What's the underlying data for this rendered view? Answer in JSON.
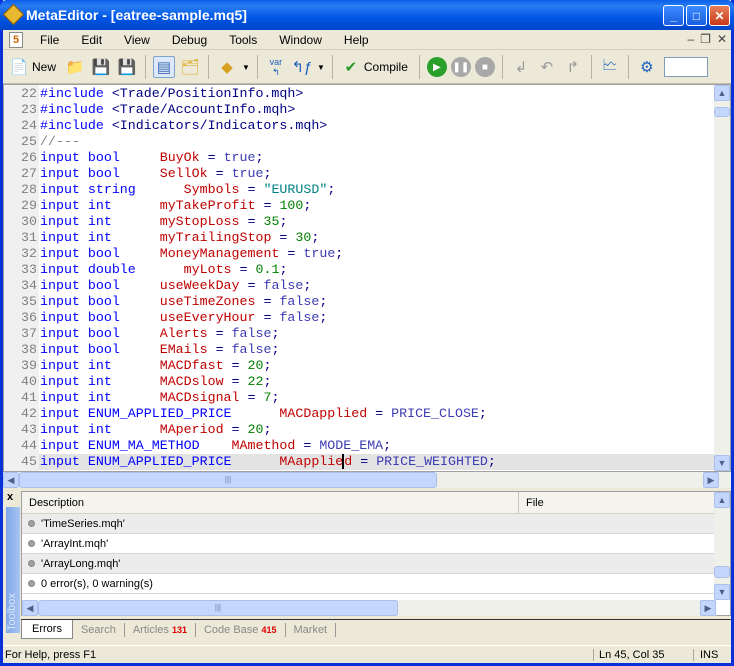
{
  "window": {
    "title": "MetaEditor - [eatree-sample.mq5]"
  },
  "menu": [
    "File",
    "Edit",
    "View",
    "Debug",
    "Tools",
    "Window",
    "Help"
  ],
  "toolbar": {
    "new_label": "New",
    "compile_label": "Compile",
    "var_label": "var"
  },
  "code": [
    {
      "n": "22",
      "tokens": [
        [
          "k",
          "#include "
        ],
        [
          "p",
          "<Trade/PositionInfo.mqh>"
        ]
      ]
    },
    {
      "n": "23",
      "tokens": [
        [
          "k",
          "#include "
        ],
        [
          "p",
          "<Trade/AccountInfo.mqh>"
        ]
      ]
    },
    {
      "n": "24",
      "tokens": [
        [
          "k",
          "#include "
        ],
        [
          "p",
          "<Indicators/Indicators.mqh>"
        ]
      ]
    },
    {
      "n": "25",
      "tokens": [
        [
          "c",
          "//---"
        ]
      ]
    },
    {
      "n": "26",
      "tokens": [
        [
          "k",
          "input "
        ],
        [
          "t",
          "bool     "
        ],
        [
          "v",
          "BuyOk"
        ],
        [
          "p",
          " = "
        ],
        [
          "e",
          "true"
        ],
        [
          "p",
          ";"
        ]
      ]
    },
    {
      "n": "27",
      "tokens": [
        [
          "k",
          "input "
        ],
        [
          "t",
          "bool     "
        ],
        [
          "v",
          "SellOk"
        ],
        [
          "p",
          " = "
        ],
        [
          "e",
          "true"
        ],
        [
          "p",
          ";"
        ]
      ]
    },
    {
      "n": "28",
      "tokens": [
        [
          "k",
          "input "
        ],
        [
          "t",
          "string      "
        ],
        [
          "v",
          "Symbols"
        ],
        [
          "p",
          " = "
        ],
        [
          "s",
          "\"EURUSD\""
        ],
        [
          "p",
          ";"
        ]
      ]
    },
    {
      "n": "29",
      "tokens": [
        [
          "k",
          "input "
        ],
        [
          "t",
          "int      "
        ],
        [
          "v",
          "myTakeProfit"
        ],
        [
          "p",
          " = "
        ],
        [
          "n",
          "100"
        ],
        [
          "p",
          ";"
        ]
      ]
    },
    {
      "n": "30",
      "tokens": [
        [
          "k",
          "input "
        ],
        [
          "t",
          "int      "
        ],
        [
          "v",
          "myStopLoss"
        ],
        [
          "p",
          " = "
        ],
        [
          "n",
          "35"
        ],
        [
          "p",
          ";"
        ]
      ]
    },
    {
      "n": "31",
      "tokens": [
        [
          "k",
          "input "
        ],
        [
          "t",
          "int      "
        ],
        [
          "v",
          "myTrailingStop"
        ],
        [
          "p",
          " = "
        ],
        [
          "n",
          "30"
        ],
        [
          "p",
          ";"
        ]
      ]
    },
    {
      "n": "32",
      "tokens": [
        [
          "k",
          "input "
        ],
        [
          "t",
          "bool     "
        ],
        [
          "v",
          "MoneyManagement"
        ],
        [
          "p",
          " = "
        ],
        [
          "e",
          "true"
        ],
        [
          "p",
          ";"
        ]
      ]
    },
    {
      "n": "33",
      "tokens": [
        [
          "k",
          "input "
        ],
        [
          "t",
          "double      "
        ],
        [
          "v",
          "myLots"
        ],
        [
          "p",
          " = "
        ],
        [
          "n",
          "0.1"
        ],
        [
          "p",
          ";"
        ]
      ]
    },
    {
      "n": "34",
      "tokens": [
        [
          "k",
          "input "
        ],
        [
          "t",
          "bool     "
        ],
        [
          "v",
          "useWeekDay"
        ],
        [
          "p",
          " = "
        ],
        [
          "e",
          "false"
        ],
        [
          "p",
          ";"
        ]
      ]
    },
    {
      "n": "35",
      "tokens": [
        [
          "k",
          "input "
        ],
        [
          "t",
          "bool     "
        ],
        [
          "v",
          "useTimeZones"
        ],
        [
          "p",
          " = "
        ],
        [
          "e",
          "false"
        ],
        [
          "p",
          ";"
        ]
      ]
    },
    {
      "n": "36",
      "tokens": [
        [
          "k",
          "input "
        ],
        [
          "t",
          "bool     "
        ],
        [
          "v",
          "useEveryHour"
        ],
        [
          "p",
          " = "
        ],
        [
          "e",
          "false"
        ],
        [
          "p",
          ";"
        ]
      ]
    },
    {
      "n": "37",
      "tokens": [
        [
          "k",
          "input "
        ],
        [
          "t",
          "bool     "
        ],
        [
          "v",
          "Alerts"
        ],
        [
          "p",
          " = "
        ],
        [
          "e",
          "false"
        ],
        [
          "p",
          ";"
        ]
      ]
    },
    {
      "n": "38",
      "tokens": [
        [
          "k",
          "input "
        ],
        [
          "t",
          "bool     "
        ],
        [
          "v",
          "EMails"
        ],
        [
          "p",
          " = "
        ],
        [
          "e",
          "false"
        ],
        [
          "p",
          ";"
        ]
      ]
    },
    {
      "n": "39",
      "tokens": [
        [
          "k",
          "input "
        ],
        [
          "t",
          "int      "
        ],
        [
          "v",
          "MACDfast"
        ],
        [
          "p",
          " = "
        ],
        [
          "n",
          "20"
        ],
        [
          "p",
          ";"
        ]
      ]
    },
    {
      "n": "40",
      "tokens": [
        [
          "k",
          "input "
        ],
        [
          "t",
          "int      "
        ],
        [
          "v",
          "MACDslow"
        ],
        [
          "p",
          " = "
        ],
        [
          "n",
          "22"
        ],
        [
          "p",
          ";"
        ]
      ]
    },
    {
      "n": "41",
      "tokens": [
        [
          "k",
          "input "
        ],
        [
          "t",
          "int      "
        ],
        [
          "v",
          "MACDsignal"
        ],
        [
          "p",
          " = "
        ],
        [
          "n",
          "7"
        ],
        [
          "p",
          ";"
        ]
      ]
    },
    {
      "n": "42",
      "tokens": [
        [
          "k",
          "input "
        ],
        [
          "t",
          "ENUM_APPLIED_PRICE      "
        ],
        [
          "v",
          "MACDapplied"
        ],
        [
          "p",
          " = "
        ],
        [
          "e",
          "PRICE_CLOSE"
        ],
        [
          "p",
          ";"
        ]
      ]
    },
    {
      "n": "43",
      "tokens": [
        [
          "k",
          "input "
        ],
        [
          "t",
          "int      "
        ],
        [
          "v",
          "MAperiod"
        ],
        [
          "p",
          " = "
        ],
        [
          "n",
          "20"
        ],
        [
          "p",
          ";"
        ]
      ]
    },
    {
      "n": "44",
      "tokens": [
        [
          "k",
          "input "
        ],
        [
          "t",
          "ENUM_MA_METHOD    "
        ],
        [
          "v",
          "MAmethod"
        ],
        [
          "p",
          " = "
        ],
        [
          "e",
          "MODE_EMA"
        ],
        [
          "p",
          ";"
        ]
      ]
    },
    {
      "n": "45",
      "current": true,
      "tokens": [
        [
          "k",
          "input "
        ],
        [
          "t",
          "ENUM_APPLIED_PRICE      "
        ],
        [
          "v",
          "MAapplie"
        ],
        [
          "caret",
          ""
        ],
        [
          "v",
          "d"
        ],
        [
          "p",
          " = "
        ],
        [
          "e",
          "PRICE_WEIGHTED"
        ],
        [
          "p",
          ";"
        ]
      ]
    }
  ],
  "toolbox": {
    "label": "Toolbox",
    "close": "x",
    "columns": [
      "Description",
      "File"
    ],
    "rows": [
      "'TimeSeries.mqh'",
      "'ArrayInt.mqh'",
      "'ArrayLong.mqh'",
      "0 error(s), 0 warning(s)"
    ],
    "tabs": [
      {
        "label": "Errors",
        "active": true
      },
      {
        "label": "Search"
      },
      {
        "label": "Articles",
        "badge": "131"
      },
      {
        "label": "Code Base",
        "badge": "415"
      },
      {
        "label": "Market"
      }
    ]
  },
  "status": {
    "help": "For Help, press F1",
    "position": "Ln 45, Col 35",
    "mode": "INS"
  }
}
